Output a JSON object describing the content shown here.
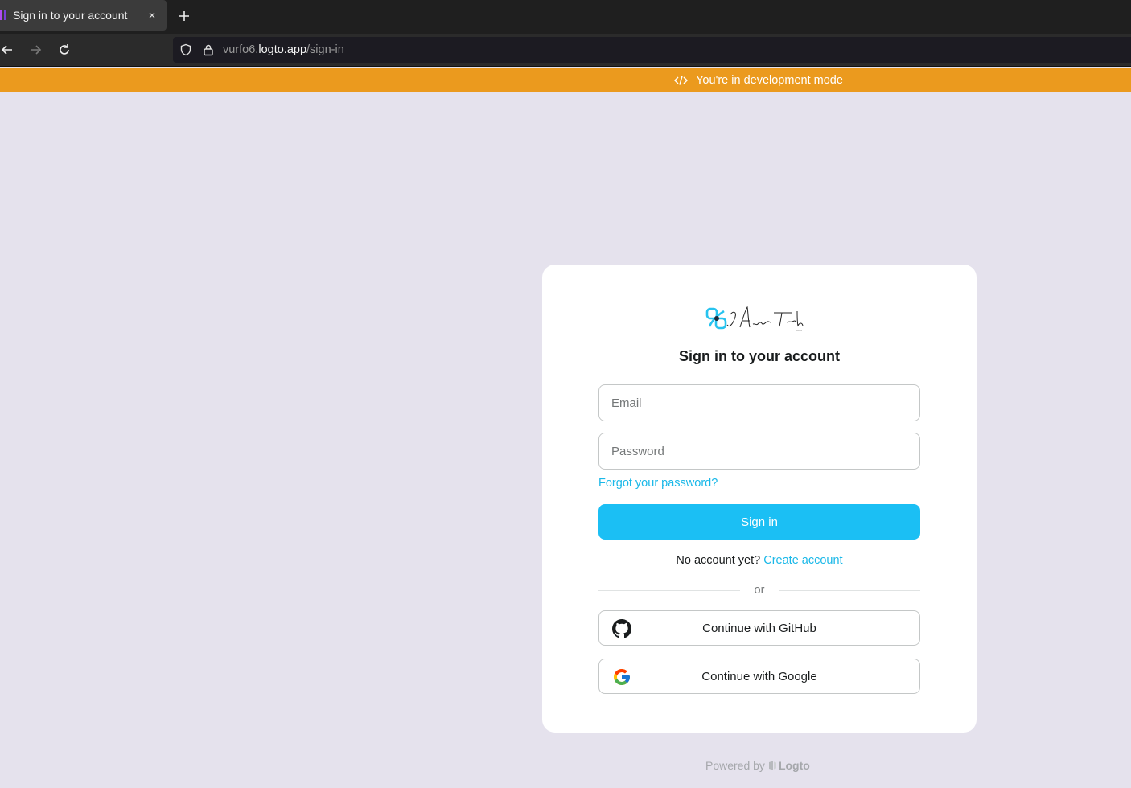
{
  "browser": {
    "tab": {
      "title": "Sign in to your account",
      "close_label": "×"
    },
    "new_tab_label": "+",
    "url": {
      "host_prefix": "vurfo6.",
      "host": "logto.app",
      "path": "/sign-in"
    }
  },
  "banner": {
    "text": "You're in development mode"
  },
  "card": {
    "title": "Sign in to your account",
    "email_placeholder": "Email",
    "password_placeholder": "Password",
    "forgot_label": "Forgot your password?",
    "signin_label": "Sign in",
    "no_account_text": "No account yet?",
    "create_account_label": "Create account",
    "divider_text": "or",
    "github_label": "Continue with GitHub",
    "google_label": "Continue with Google"
  },
  "footer": {
    "powered_by": "Powered by",
    "brand": "Logto"
  },
  "colors": {
    "accent": "#1bbff4",
    "banner": "#eb9a1e",
    "background": "#e5e2ed"
  }
}
